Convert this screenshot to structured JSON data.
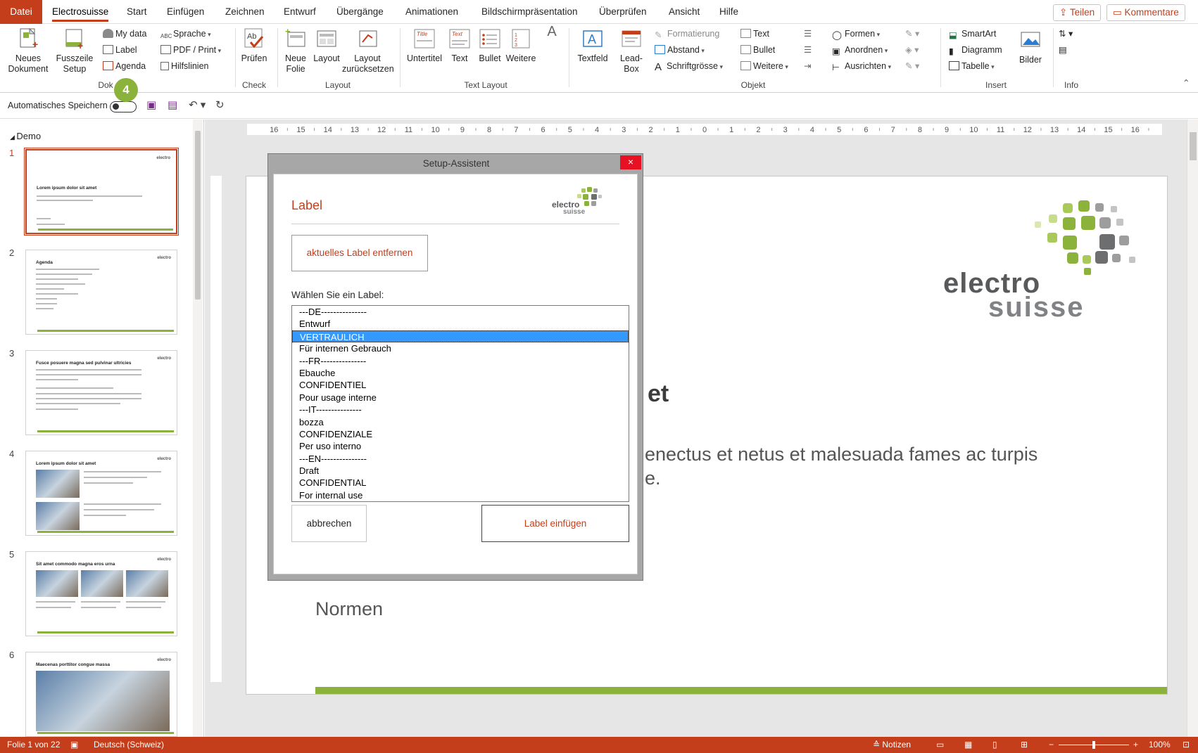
{
  "menu": {
    "file": "Datei",
    "tabs": [
      "Electrosuisse",
      "Start",
      "Einfügen",
      "Zeichnen",
      "Entwurf",
      "Übergänge",
      "Animationen",
      "Bildschirmpräsentation",
      "Überprüfen",
      "Ansicht",
      "Hilfe"
    ],
    "active_tab": "Electrosuisse",
    "share": "Teilen",
    "comments": "Kommentare"
  },
  "ribbon": {
    "dok": {
      "new_doc": "Neues Dokument",
      "footer_setup": "Fusszeile Setup",
      "my_data": "My data",
      "label": "Label",
      "agenda": "Agenda",
      "sprache": "Sprache",
      "pdf_print": "PDF / Print",
      "hilfslinien": "Hilfslinien",
      "group": "Dok"
    },
    "check": {
      "pruefen": "Prüfen",
      "group": "Check"
    },
    "layout": {
      "neue_folie": "Neue Folie",
      "layout": "Layout",
      "reset": "Layout zurücksetzen",
      "group": "Layout"
    },
    "textlayout": {
      "untertitel": "Untertitel",
      "text": "Text",
      "bullet": "Bullet",
      "weitere": "Weitere",
      "group": "Text Layout"
    },
    "objekt": {
      "textfeld": "Textfeld",
      "leadbox": "Lead-Box",
      "formatierung": "Formatierung",
      "abstand": "Abstand",
      "schriftgroesse": "Schriftgrösse",
      "text": "Text",
      "bullet": "Bullet",
      "weitere": "Weitere",
      "formen": "Formen",
      "anordnen": "Anordnen",
      "ausrichten": "Ausrichten",
      "group": "Objekt"
    },
    "insert": {
      "smartart": "SmartArt",
      "diagramm": "Diagramm",
      "tabelle": "Tabelle",
      "bilder": "Bilder",
      "group": "Insert"
    },
    "info": {
      "group": "Info"
    }
  },
  "qat": {
    "autosave": "Automatisches Speichern",
    "badge": "4"
  },
  "slides_panel": {
    "section": "Demo",
    "thumbs": [
      {
        "num": "1",
        "title": "Lorem ipsum dolor sit amet"
      },
      {
        "num": "2",
        "title": "Agenda"
      },
      {
        "num": "3",
        "title": "Fusce posuere magna sed pulvinar ultricies"
      },
      {
        "num": "4",
        "title": "Lorem ipsum dolor sit amet"
      },
      {
        "num": "5",
        "title": "Sit amet commodo magna eros urna"
      },
      {
        "num": "6",
        "title": "Maecenas porttitor congue massa"
      }
    ]
  },
  "slide": {
    "title_fragment": "et",
    "subtext_line1": "enectus et netus et malesuada fames ac turpis",
    "subtext_line2": "e.",
    "normen": "Normen",
    "brand_word1": "electro",
    "brand_word2": "suisse"
  },
  "ruler": {
    "marks": [
      "16",
      "15",
      "14",
      "13",
      "12",
      "11",
      "10",
      "9",
      "8",
      "7",
      "6",
      "5",
      "4",
      "3",
      "2",
      "1",
      "0",
      "1",
      "2",
      "3",
      "4",
      "5",
      "6",
      "7",
      "8",
      "9",
      "10",
      "11",
      "12",
      "13",
      "14",
      "15",
      "16"
    ]
  },
  "dialog": {
    "title": "Setup-Assistent",
    "close": "×",
    "heading": "Label",
    "logo1": "electro",
    "logo2": "suisse",
    "remove_btn": "aktuelles Label entfernen",
    "choose": "Wählen Sie ein Label:",
    "options": [
      "---DE---------------",
      "Entwurf",
      "VERTRAULICH",
      "Für internen Gebrauch",
      "---FR---------------",
      "Ebauche",
      "CONFIDENTIEL",
      "Pour usage interne",
      "---IT---------------",
      "bozza",
      "CONFIDENZIALE",
      "Per uso interno",
      "---EN---------------",
      "Draft",
      "CONFIDENTIAL",
      "For internal use"
    ],
    "selected": "VERTRAULICH",
    "cancel": "abbrechen",
    "insert": "Label einfügen"
  },
  "status": {
    "slide": "Folie 1 von 22",
    "lang": "Deutsch (Schweiz)",
    "notes": "Notizen",
    "zoom": "100%"
  },
  "colors": {
    "accent": "#c43e1c",
    "brand_green": "#8bb33b",
    "select_blue": "#3399ff"
  }
}
